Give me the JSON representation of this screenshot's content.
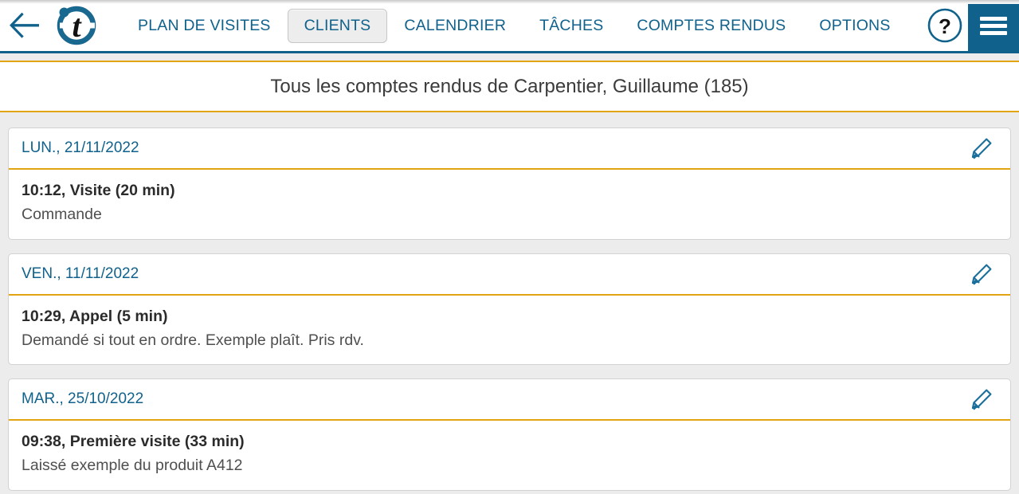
{
  "colors": {
    "brand_blue": "#10628c",
    "accent_gold": "#e2a410",
    "page_bg": "#ececec",
    "card_bg": "#ffffff",
    "text_dark": "#2b2b2b",
    "text_muted": "#4f4f4f"
  },
  "header": {
    "back_icon": "back-arrow-icon",
    "logo_letter": "t",
    "logo_name": "app-logo",
    "help_icon": "question-mark-icon",
    "menu_icon": "hamburger-menu-icon",
    "nav": [
      {
        "label": "PLAN DE VISITES",
        "active": false,
        "name": "plan-de-visites"
      },
      {
        "label": "CLIENTS",
        "active": true,
        "name": "clients"
      },
      {
        "label": "CALENDRIER",
        "active": false,
        "name": "calendrier"
      },
      {
        "label": "TÂCHES",
        "active": false,
        "name": "taches"
      },
      {
        "label": "COMPTES RENDUS",
        "active": false,
        "name": "comptes-rendus"
      },
      {
        "label": "OPTIONS",
        "active": false,
        "name": "options"
      }
    ]
  },
  "title_bar": {
    "title": "Tous les comptes rendus de Carpentier, Guillaume (185)"
  },
  "reports": [
    {
      "date": "LUN., 21/11/2022",
      "edit_icon": "pencil-edit-icon",
      "entry_title": "10:12, Visite (20 min)",
      "entry_note": "Commande"
    },
    {
      "date": "VEN., 11/11/2022",
      "edit_icon": "pencil-edit-icon",
      "entry_title": "10:29, Appel (5 min)",
      "entry_note": "Demandé si tout en ordre. Exemple plaît. Pris rdv."
    },
    {
      "date": "MAR., 25/10/2022",
      "edit_icon": "pencil-edit-icon",
      "entry_title": "09:38, Première visite (33 min)",
      "entry_note": "Laissé exemple du produit A412"
    }
  ]
}
